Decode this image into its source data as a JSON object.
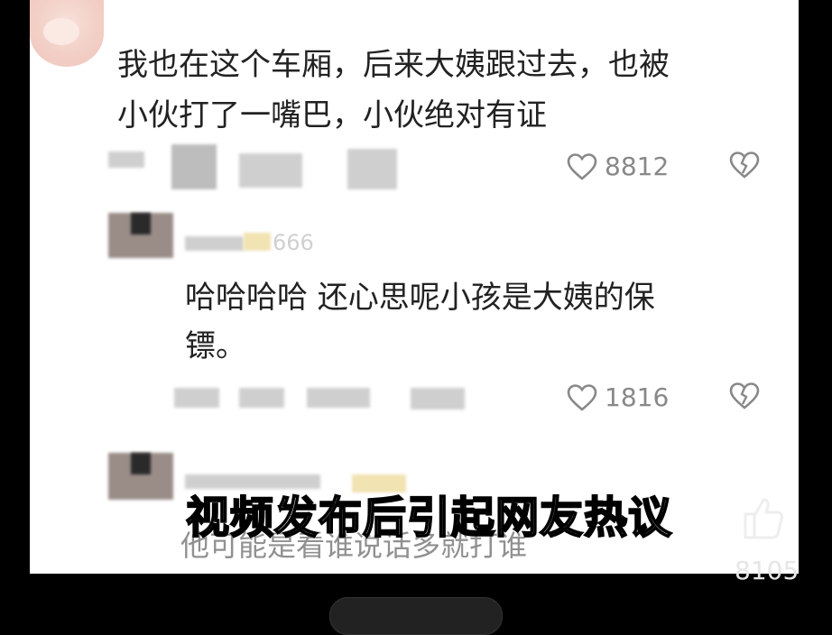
{
  "comments": [
    {
      "text_line1": "我也在这个车厢，后来大姨跟过去，也被",
      "text_line2": "小伙打了一嘴巴，小伙绝对有证",
      "likes": "8812"
    },
    {
      "user_suffix": "666",
      "text_line1": "哈哈哈哈 还心思呢小孩是大姨的保",
      "text_line2": "镖。",
      "likes": "1816"
    }
  ],
  "overlay": {
    "subtitle": "视频发布后引起网友热议",
    "faded_comment": "他可能是看谁说话多就打谁",
    "count": "8105"
  },
  "icons": {
    "like": "heart-outline-icon",
    "dislike": "broken-heart-icon"
  },
  "colors": {
    "background": "#000000",
    "card": "#ffffff",
    "text": "#222222",
    "meta": "#888888"
  }
}
